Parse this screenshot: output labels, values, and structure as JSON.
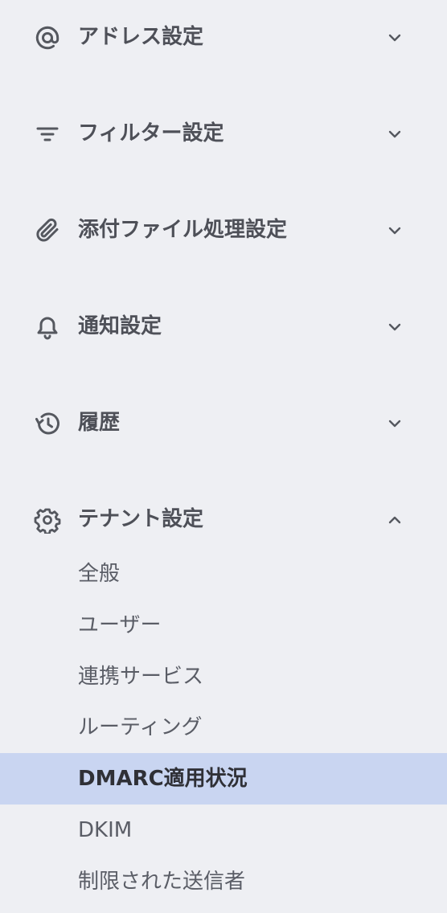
{
  "menu": {
    "sections": [
      {
        "label": "アドレス設定",
        "icon": "at-sign-icon",
        "expanded": false
      },
      {
        "label": "フィルター設定",
        "icon": "filter-icon",
        "expanded": false
      },
      {
        "label": "添付ファイル処理設定",
        "icon": "paperclip-icon",
        "expanded": false
      },
      {
        "label": "通知設定",
        "icon": "bell-icon",
        "expanded": false
      },
      {
        "label": "履歴",
        "icon": "history-icon",
        "expanded": false
      },
      {
        "label": "テナント設定",
        "icon": "gear-icon",
        "expanded": true
      }
    ],
    "tenant_items": [
      {
        "label": "全般"
      },
      {
        "label": "ユーザー"
      },
      {
        "label": "連携サービス"
      },
      {
        "label": "ルーティング"
      },
      {
        "label": "DMARC適用状況",
        "active": true
      },
      {
        "label": "DKIM"
      },
      {
        "label": "制限された送信者"
      }
    ]
  },
  "colors": {
    "background": "#eeeff3",
    "active_background": "#c9d5f1",
    "text": "#4e5058"
  }
}
